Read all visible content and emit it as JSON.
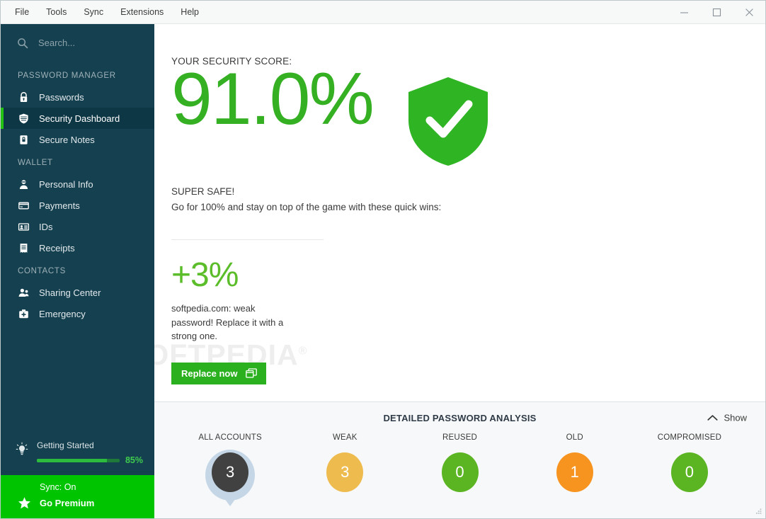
{
  "window": {
    "menu": [
      "File",
      "Tools",
      "Sync",
      "Extensions",
      "Help"
    ],
    "minimize_label": "Minimize",
    "maximize_label": "Maximize",
    "close_label": "Close"
  },
  "sidebar": {
    "search": {
      "value": "",
      "placeholder": "Search..."
    },
    "groups": [
      {
        "title": "PASSWORD MANAGER",
        "items": [
          {
            "label": "Passwords",
            "icon": "lock-icon",
            "active": false
          },
          {
            "label": "Security Dashboard",
            "icon": "shield-icon",
            "active": true
          },
          {
            "label": "Secure Notes",
            "icon": "note-lock-icon",
            "active": false
          }
        ]
      },
      {
        "title": "WALLET",
        "items": [
          {
            "label": "Personal Info",
            "icon": "person-icon",
            "active": false
          },
          {
            "label": "Payments",
            "icon": "credit-card-icon",
            "active": false
          },
          {
            "label": "IDs",
            "icon": "id-card-icon",
            "active": false
          },
          {
            "label": "Receipts",
            "icon": "receipt-icon",
            "active": false
          }
        ]
      },
      {
        "title": "CONTACTS",
        "items": [
          {
            "label": "Sharing Center",
            "icon": "people-icon",
            "active": false
          },
          {
            "label": "Emergency",
            "icon": "first-aid-kit-icon",
            "active": false
          }
        ]
      }
    ],
    "getting_started": {
      "label": "Getting Started",
      "percent_label": "85%",
      "percent_value": 85,
      "icon": "lightbulb-icon"
    },
    "footer": {
      "sync_label": "Sync: On",
      "premium_label": "Go Premium",
      "premium_icon": "star-icon"
    }
  },
  "main": {
    "score_caption": "YOUR SECURITY SCORE:",
    "score_value": "91.0%",
    "score_icon": "shield-check-icon",
    "status_headline": "SUPER SAFE!",
    "status_sub": "Go for 100% and stay on top of the game with these quick wins:",
    "tip": {
      "gain": "+3%",
      "description": "softpedia.com: weak password! Replace it with a strong one.",
      "button_label": "Replace now",
      "button_icon": "open-window-icon"
    },
    "watermark": "SOFTPEDIA"
  },
  "analysis": {
    "title": "DETAILED PASSWORD ANALYSIS",
    "toggle_label": "Show",
    "toggle_icon": "chevron-up-icon",
    "stats": [
      {
        "label": "ALL ACCOUNTS",
        "value": "3",
        "color": "#414141",
        "halo": true
      },
      {
        "label": "WEAK",
        "value": "3",
        "color": "#eebb4e",
        "halo": false
      },
      {
        "label": "REUSED",
        "value": "0",
        "color": "#5bb422",
        "halo": false
      },
      {
        "label": "OLD",
        "value": "1",
        "color": "#f79420",
        "halo": false
      },
      {
        "label": "COMPROMISED",
        "value": "0",
        "color": "#5bb422",
        "halo": false
      }
    ]
  },
  "colors": {
    "sidebar_bg": "#15404f",
    "sidebar_active_bg": "#0e3746",
    "accent_green": "#23c113",
    "score_green": "#35b023",
    "premium_green": "#00c400",
    "panel_bg": "#f7f8f9"
  }
}
